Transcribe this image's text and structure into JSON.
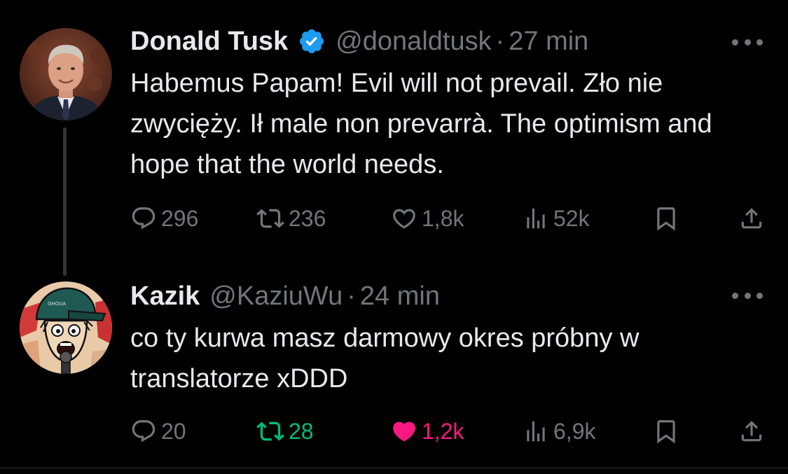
{
  "thread": [
    {
      "display_name": "Donald Tusk",
      "verified": true,
      "handle": "@donaldtusk",
      "separator": "·",
      "time": "27 min",
      "text": "Habemus Papam! Evil will not prevail. Zło nie zwycięży. Ił male non prevarrà. The optimism and hope that the world needs.",
      "stats": {
        "replies": "296",
        "reposts": "236",
        "likes": "1,8k",
        "views": "52k"
      },
      "liked": false,
      "reposted": false,
      "avatar_icon": "person-avatar-icon"
    },
    {
      "display_name": "Kazik",
      "verified": false,
      "handle": "@KaziuWu",
      "separator": "·",
      "time": "24 min",
      "text": "co ty kurwa masz darmowy okres próbny w translatorze xDDD",
      "stats": {
        "replies": "20",
        "reposts": "28",
        "likes": "1,2k",
        "views": "6,9k"
      },
      "liked": true,
      "reposted": true,
      "avatar_icon": "cartoon-avatar-icon",
      "avatar_cap_text": "GHOUA"
    }
  ],
  "colors": {
    "background": "#000000",
    "text_primary": "#e7e9ea",
    "text_secondary": "#71767b",
    "verified_blue": "#1d9bf0",
    "repost_green": "#00ba7c",
    "like_pink": "#f91880",
    "thread_line": "#333639"
  },
  "icons": {
    "reply": "reply-icon",
    "repost": "repost-icon",
    "like": "heart-icon",
    "views": "views-chart-icon",
    "bookmark": "bookmark-icon",
    "share": "share-icon",
    "more": "more-dots-icon",
    "verified": "verified-badge-icon"
  }
}
